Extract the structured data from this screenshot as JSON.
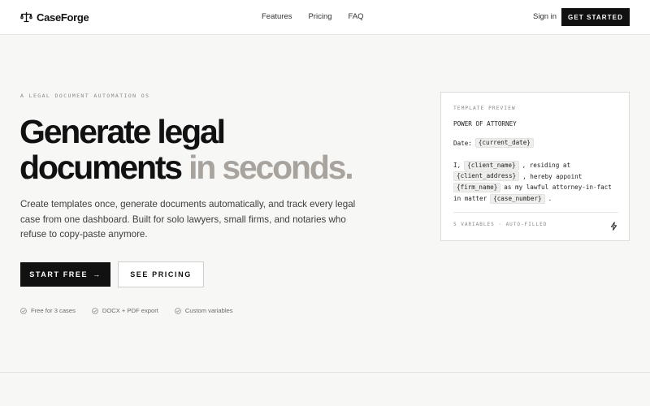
{
  "nav": {
    "brand": "CaseForge",
    "links": [
      "Features",
      "Pricing",
      "FAQ"
    ],
    "signin": "Sign in",
    "cta": "GET STARTED"
  },
  "hero": {
    "eyebrow": "A LEGAL DOCUMENT AUTOMATION OS",
    "headline_line1": "Generate legal",
    "headline_line2_dark": "documents",
    "headline_line2_muted": "in seconds.",
    "subtitle": "Create templates once, generate documents automatically, and track every legal case from one dashboard. Built for solo lawyers, small firms, and notaries who refuse to copy-paste anymore.",
    "primary_cta": "START FREE",
    "primary_cta_arrow": "→",
    "secondary_cta": "SEE PRICING",
    "features": [
      "Free for 3 cases",
      "DOCX + PDF export",
      "Custom variables"
    ]
  },
  "preview": {
    "label": "TEMPLATE PREVIEW",
    "title": "POWER OF ATTORNEY",
    "date_label": "Date:",
    "date_var": "{current_date}",
    "body": {
      "l1_a": "I,",
      "l1_var": "{client_name}",
      "l1_b": ", residing at",
      "l2_var": "{client_address}",
      "l2_b": ", hereby appoint",
      "l3_var": "{firm_name}",
      "l3_b": "as my lawful attorney-in-fact",
      "l4_a": "in matter",
      "l4_var": "{case_number}",
      "l4_b": "."
    },
    "footer": "5 VARIABLES · AUTO-FILLED"
  },
  "colors": {
    "primary": "#111111",
    "muted_headline": "#a8a39d",
    "background": "#f7f7f6"
  }
}
